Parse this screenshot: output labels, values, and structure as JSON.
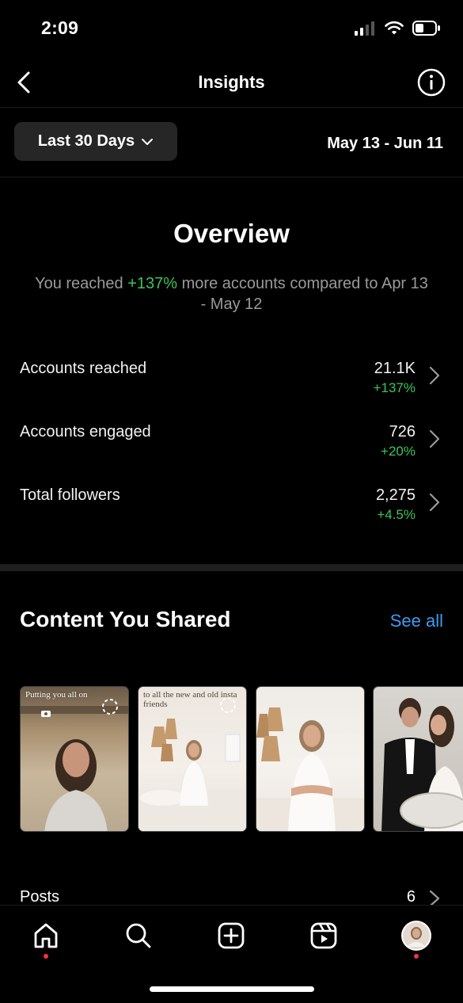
{
  "status_bar": {
    "time": "2:09"
  },
  "nav": {
    "title": "Insights"
  },
  "filter": {
    "range_label": "Last 30 Days",
    "date_range": "May 13 - Jun 11"
  },
  "overview": {
    "title": "Overview",
    "desc_prefix": "You reached ",
    "desc_highlight": "+137%",
    "desc_suffix": " more accounts compared to Apr 13 - May 12"
  },
  "metrics": [
    {
      "label": "Accounts reached",
      "value": "21.1K",
      "change": "+137%"
    },
    {
      "label": "Accounts engaged",
      "value": "726",
      "change": "+20%"
    },
    {
      "label": "Total followers",
      "value": "2,275",
      "change": "+4.5%"
    }
  ],
  "content": {
    "title": "Content You Shared",
    "see_all": "See all",
    "thumbnails": [
      {
        "caption": "Putting you all on"
      },
      {
        "caption": "to all the new and old insta friends"
      },
      {
        "caption": ""
      },
      {
        "caption": ""
      }
    ]
  },
  "posts": {
    "label": "Posts",
    "count": "6"
  },
  "colors": {
    "positive": "#3cc55a",
    "link": "#3f9bf4",
    "notification_dot": "#ff3040"
  },
  "icons": {
    "nav": [
      "back-chevron-icon",
      "info-icon"
    ],
    "tabs": [
      "home-icon",
      "search-icon",
      "create-icon",
      "reels-icon",
      "profile-avatar"
    ]
  }
}
